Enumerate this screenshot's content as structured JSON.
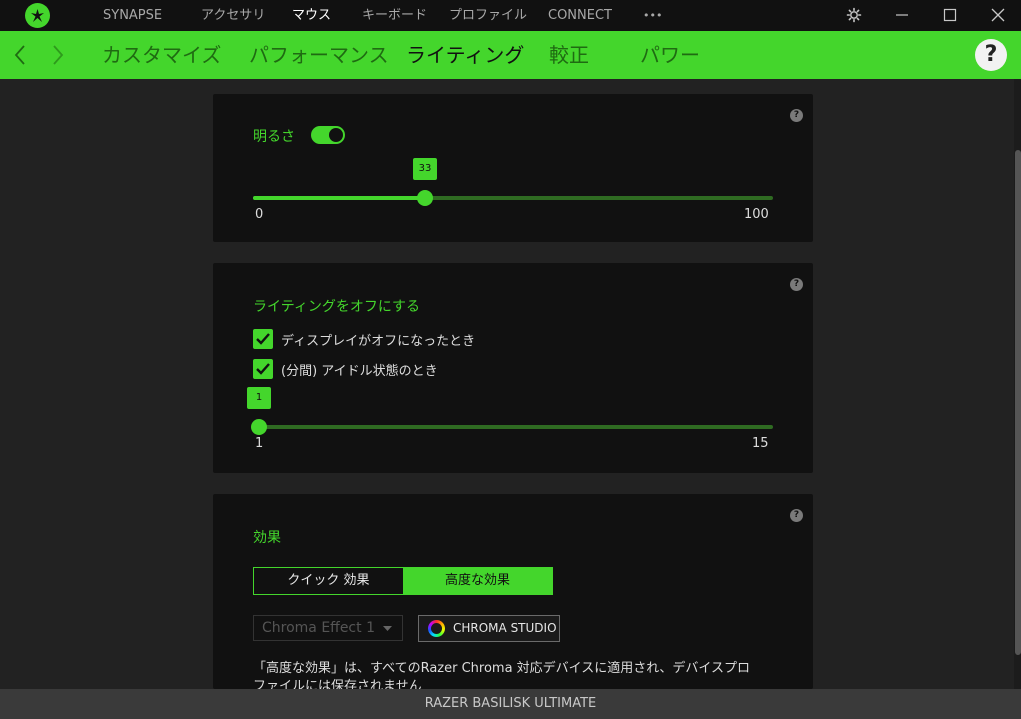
{
  "titlebar": {
    "nav": [
      {
        "label": "SYNAPSE",
        "active": false
      },
      {
        "label": "アクセサリ",
        "active": false
      },
      {
        "label": "マウス",
        "active": true
      },
      {
        "label": "キーボード",
        "active": false
      },
      {
        "label": "プロファイル",
        "active": false
      },
      {
        "label": "CONNECT",
        "active": false
      }
    ],
    "more": "•••"
  },
  "subbar": {
    "tabs": [
      {
        "label": "カスタマイズ",
        "active": false
      },
      {
        "label": "パフォーマンス",
        "active": false
      },
      {
        "label": "ライティング",
        "active": true
      },
      {
        "label": "較正",
        "active": false
      },
      {
        "label": "パワー",
        "active": false
      }
    ],
    "help": "?"
  },
  "brightness": {
    "title": "明るさ",
    "enabled": true,
    "value": "33",
    "value_num": 33,
    "min": "0",
    "max": "100",
    "help": "?"
  },
  "lighting_off": {
    "title": "ライティングをオフにする",
    "options": [
      {
        "label": "ディスプレイがオフになったとき",
        "checked": true
      },
      {
        "label": "(分間) アイドル状態のとき",
        "checked": true
      }
    ],
    "value": "1",
    "value_num": 1,
    "min": "1",
    "max": "15",
    "min_num": 1,
    "max_num": 15,
    "help": "?"
  },
  "effects": {
    "title": "効果",
    "segments": [
      {
        "label": "クイック 効果",
        "active": false
      },
      {
        "label": "高度な効果",
        "active": true
      }
    ],
    "select_value": "Chroma Effect 1",
    "chroma_button": "CHROMA STUDIO",
    "description_line1": "「高度な効果」は、すべてのRazer Chroma 対応デバイスに適用され、デバイスプロ",
    "description_line2": "ファイルには保存されません",
    "help": "?"
  },
  "footer": {
    "device": "RAZER BASILISK ULTIMATE"
  },
  "colors": {
    "accent": "#44d62c",
    "background": "#222222",
    "card": "#111111",
    "titlebar": "#111111"
  }
}
